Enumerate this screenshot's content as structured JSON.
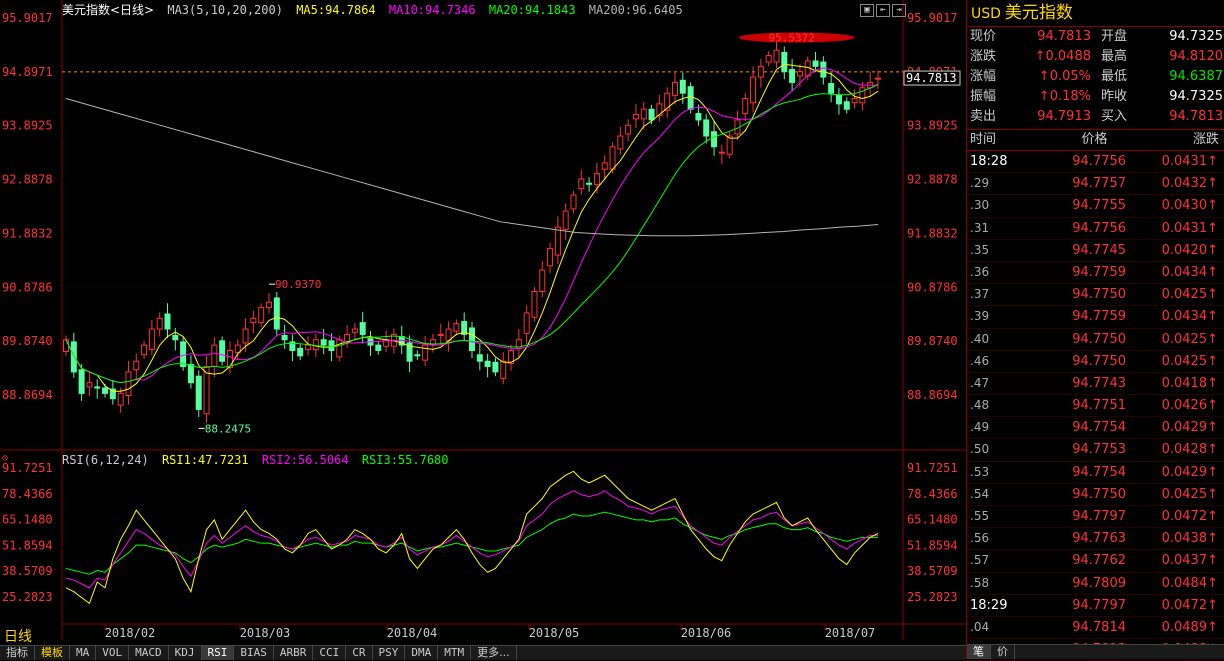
{
  "title": "美元指数<日线>",
  "ma_legend": {
    "name": "MA3(5,10,20,200)",
    "ma5": "MA5:94.7864",
    "ma10": "MA10:94.7346",
    "ma20": "MA20:94.1843",
    "ma200": "MA200:96.6405"
  },
  "colors": {
    "ma5": "#ffff00",
    "ma10": "#ff00ff",
    "ma20": "#00ff00",
    "ma200": "#b4b4b4",
    "up": "#ff3232",
    "down": "#54ffa0",
    "grid": "#8b0000"
  },
  "price_axis": [
    "95.9017",
    "94.8971",
    "93.8925",
    "92.8878",
    "91.8832",
    "90.8786",
    "89.8740",
    "88.8694"
  ],
  "last_price": "94.7813",
  "dashed_price": "94.8971",
  "annotations": {
    "high": "95.5372",
    "mid_high": "90.9370",
    "low": "88.2475"
  },
  "rsi_legend": {
    "name": "RSI(6,12,24)",
    "rsi1": "RSI1:47.7231",
    "rsi2": "RSI2:56.5064",
    "rsi3": "RSI3:55.7680"
  },
  "rsi_axis": [
    "91.7251",
    "78.4366",
    "65.1480",
    "51.8594",
    "38.5709",
    "25.2823"
  ],
  "date_axis": [
    "2018/02",
    "2018/03",
    "2018/04",
    "2018/05",
    "2018/06",
    "2018/07"
  ],
  "period": "日线",
  "tabs": [
    "指标",
    "模板",
    "MA",
    "VOL",
    "MACD",
    "KDJ",
    "RSI",
    "BIAS",
    "ARBR",
    "CCI",
    "CR",
    "PSY",
    "DMA",
    "MTM",
    "更多..."
  ],
  "window_buttons": [
    "▣",
    "⇤",
    "⇥"
  ],
  "chart_data": {
    "type": "candlestick",
    "ylim": [
      88.0,
      96.0
    ],
    "rsi_ylim": [
      15,
      100
    ],
    "highlights": {
      "high": 95.5372,
      "mid_high": 90.937,
      "low": 88.2475
    },
    "close": [
      89.9,
      89.3,
      88.9,
      89.1,
      89.0,
      88.9,
      88.8,
      88.9,
      89.3,
      89.5,
      89.8,
      90.1,
      90.3,
      90.1,
      89.9,
      89.4,
      89.1,
      88.6,
      89.4,
      89.8,
      89.5,
      89.7,
      89.8,
      90.1,
      90.3,
      90.5,
      90.6,
      90.1,
      89.9,
      89.7,
      89.6,
      89.8,
      89.9,
      89.8,
      89.7,
      89.9,
      90.0,
      90.1,
      90.0,
      89.8,
      89.7,
      89.9,
      90.0,
      89.8,
      89.5,
      89.6,
      89.8,
      89.9,
      90.0,
      90.1,
      90.2,
      90.0,
      89.7,
      89.5,
      89.4,
      89.3,
      89.5,
      89.7,
      89.9,
      90.4,
      90.8,
      91.2,
      91.6,
      92.0,
      92.3,
      92.6,
      92.9,
      92.8,
      93.0,
      93.2,
      93.5,
      93.7,
      93.9,
      94.1,
      94.2,
      94.0,
      94.3,
      94.5,
      94.7,
      94.5,
      94.2,
      94.0,
      93.7,
      93.5,
      93.4,
      93.7,
      94.0,
      94.4,
      94.8,
      95.0,
      95.2,
      95.3,
      94.9,
      94.7,
      94.9,
      95.1,
      95.0,
      94.8,
      94.5,
      94.3,
      94.2,
      94.4,
      94.6,
      94.7,
      94.78
    ],
    "rsi1": [
      30,
      28,
      25,
      22,
      33,
      30,
      45,
      55,
      62,
      70,
      65,
      60,
      55,
      50,
      45,
      35,
      28,
      45,
      60,
      65,
      55,
      60,
      65,
      70,
      64,
      60,
      58,
      55,
      50,
      48,
      52,
      58,
      60,
      55,
      50,
      52,
      55,
      60,
      58,
      55,
      50,
      48,
      52,
      58,
      45,
      40,
      45,
      50,
      52,
      56,
      60,
      55,
      48,
      42,
      38,
      40,
      45,
      50,
      55,
      68,
      72,
      76,
      82,
      85,
      88,
      90,
      86,
      84,
      86,
      88,
      84,
      80,
      76,
      74,
      72,
      70,
      72,
      74,
      76,
      68,
      60,
      55,
      50,
      46,
      44,
      52,
      58,
      64,
      68,
      70,
      72,
      74,
      66,
      62,
      64,
      66,
      60,
      55,
      50,
      45,
      42,
      48,
      52,
      56,
      58
    ],
    "rsi2": [
      35,
      34,
      32,
      30,
      35,
      34,
      42,
      48,
      54,
      60,
      58,
      55,
      52,
      50,
      47,
      41,
      36,
      44,
      53,
      57,
      53,
      56,
      59,
      62,
      59,
      57,
      56,
      54,
      51,
      50,
      52,
      55,
      56,
      54,
      52,
      53,
      54,
      57,
      56,
      55,
      52,
      51,
      53,
      56,
      50,
      47,
      49,
      51,
      52,
      54,
      57,
      54,
      51,
      48,
      46,
      47,
      49,
      51,
      54,
      62,
      65,
      68,
      73,
      76,
      78,
      80,
      78,
      77,
      78,
      80,
      77,
      75,
      72,
      71,
      70,
      68,
      70,
      71,
      72,
      67,
      62,
      59,
      56,
      53,
      52,
      56,
      59,
      62,
      65,
      66,
      68,
      69,
      65,
      62,
      63,
      64,
      61,
      58,
      55,
      52,
      50,
      53,
      55,
      57,
      57
    ],
    "rsi3": [
      40,
      39,
      38,
      37,
      39,
      38,
      42,
      45,
      48,
      52,
      52,
      51,
      50,
      49,
      48,
      45,
      43,
      46,
      50,
      52,
      51,
      52,
      53,
      55,
      54,
      53,
      53,
      52,
      51,
      50,
      51,
      52,
      53,
      52,
      51,
      52,
      52,
      54,
      53,
      53,
      52,
      51,
      52,
      53,
      51,
      49,
      50,
      51,
      51,
      52,
      53,
      52,
      51,
      50,
      49,
      49,
      50,
      51,
      52,
      56,
      58,
      60,
      63,
      65,
      66,
      68,
      67,
      67,
      68,
      69,
      68,
      67,
      66,
      65,
      65,
      64,
      65,
      65,
      66,
      63,
      61,
      59,
      57,
      56,
      55,
      57,
      58,
      60,
      61,
      62,
      63,
      63,
      61,
      60,
      60,
      61,
      59,
      58,
      56,
      55,
      54,
      55,
      56,
      56,
      56
    ],
    "ma200": [
      94.4,
      94.3,
      94.2,
      94.1,
      94.0,
      93.9,
      93.8,
      93.7,
      93.6,
      93.5,
      93.4,
      93.3,
      93.2,
      93.1,
      93.0,
      92.9,
      92.8,
      92.7,
      92.6,
      92.5,
      92.4,
      92.3,
      92.2,
      92.1,
      92.05,
      92.0,
      91.95,
      91.9,
      91.88,
      91.86,
      91.85,
      91.84,
      91.84,
      91.84,
      91.85,
      91.86,
      91.88,
      91.9,
      91.92,
      91.95,
      91.97,
      92.0,
      92.02,
      92.05
    ]
  },
  "panel": {
    "code": "USD",
    "name": "美元指数",
    "quote": [
      {
        "l1": "现价",
        "v1": "94.7813",
        "c1": "red",
        "l2": "开盘",
        "v2": "94.7325",
        "c2": "white"
      },
      {
        "l1": "涨跌",
        "v1": "↑0.0488",
        "c1": "red",
        "l2": "最高",
        "v2": "94.8120",
        "c2": "red"
      },
      {
        "l1": "涨幅",
        "v1": "↑0.05%",
        "c1": "red",
        "l2": "最低",
        "v2": "94.6387",
        "c2": "green"
      },
      {
        "l1": "振幅",
        "v1": "↑0.18%",
        "c1": "red",
        "l2": "昨收",
        "v2": "94.7325",
        "c2": "white"
      },
      {
        "l1": "卖出",
        "v1": "94.7913",
        "c1": "red",
        "l2": "买入",
        "v2": "94.7813",
        "c2": "red"
      }
    ],
    "table_header": {
      "time": "时间",
      "price": "价格",
      "change": "涨跌"
    },
    "ticks": [
      {
        "t": "18:28",
        "p": "94.7756",
        "c": "0.0431↑",
        "big": true
      },
      {
        "t": ".29",
        "p": "94.7757",
        "c": "0.0432↑"
      },
      {
        "t": ".30",
        "p": "94.7755",
        "c": "0.0430↑"
      },
      {
        "t": ".31",
        "p": "94.7756",
        "c": "0.0431↑"
      },
      {
        "t": ".35",
        "p": "94.7745",
        "c": "0.0420↑"
      },
      {
        "t": ".36",
        "p": "94.7759",
        "c": "0.0434↑"
      },
      {
        "t": ".37",
        "p": "94.7750",
        "c": "0.0425↑"
      },
      {
        "t": ".39",
        "p": "94.7759",
        "c": "0.0434↑"
      },
      {
        "t": ".40",
        "p": "94.7750",
        "c": "0.0425↑"
      },
      {
        "t": ".46",
        "p": "94.7750",
        "c": "0.0425↑"
      },
      {
        "t": ".47",
        "p": "94.7743",
        "c": "0.0418↑"
      },
      {
        "t": ".48",
        "p": "94.7751",
        "c": "0.0426↑"
      },
      {
        "t": ".49",
        "p": "94.7754",
        "c": "0.0429↑"
      },
      {
        "t": ".50",
        "p": "94.7753",
        "c": "0.0428↑"
      },
      {
        "t": ".53",
        "p": "94.7754",
        "c": "0.0429↑"
      },
      {
        "t": ".54",
        "p": "94.7750",
        "c": "0.0425↑"
      },
      {
        "t": ".55",
        "p": "94.7797",
        "c": "0.0472↑"
      },
      {
        "t": ".56",
        "p": "94.7763",
        "c": "0.0438↑"
      },
      {
        "t": ".57",
        "p": "94.7762",
        "c": "0.0437↑"
      },
      {
        "t": ".58",
        "p": "94.7809",
        "c": "0.0484↑"
      },
      {
        "t": "18:29",
        "p": "94.7797",
        "c": "0.0472↑",
        "big": true
      },
      {
        "t": ".04",
        "p": "94.7814",
        "c": "0.0489↑"
      },
      {
        "t": ".05",
        "p": "94.7813",
        "c": "0.0488↑"
      }
    ],
    "footer": [
      "笔",
      "价"
    ]
  }
}
